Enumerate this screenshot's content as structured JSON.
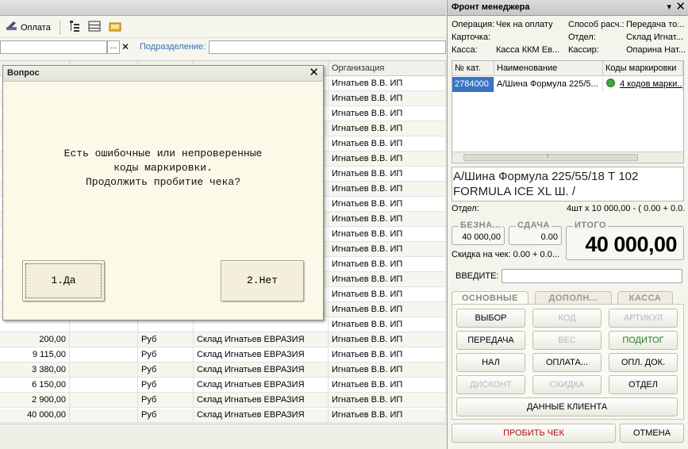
{
  "main": {
    "toolbar": {
      "pay_label": "Оплата"
    },
    "filter": {
      "dots": "...",
      "clear": "✕",
      "dept_label": "Подразделение:"
    },
    "grid": {
      "headers": {
        "org": "Организация"
      },
      "rows": [
        {
          "sum": "",
          "cur": "",
          "wh": "",
          "org": "Игнатьев В.В. ИП"
        },
        {
          "sum": "",
          "cur": "",
          "wh": "",
          "org": "Игнатьев В.В. ИП"
        },
        {
          "sum": "",
          "cur": "",
          "wh": "",
          "org": "Игнатьев В.В. ИП"
        },
        {
          "sum": "",
          "cur": "",
          "wh": "",
          "org": "Игнатьев В.В. ИП"
        },
        {
          "sum": "",
          "cur": "",
          "wh": "",
          "org": "Игнатьев В.В. ИП"
        },
        {
          "sum": "",
          "cur": "",
          "wh": "",
          "org": "Игнатьев В.В. ИП"
        },
        {
          "sum": "",
          "cur": "",
          "wh": "",
          "org": "Игнатьев В.В. ИП"
        },
        {
          "sum": "",
          "cur": "",
          "wh": "",
          "org": "Игнатьев В.В. ИП"
        },
        {
          "sum": "",
          "cur": "",
          "wh": "",
          "org": "Игнатьев В.В. ИП"
        },
        {
          "sum": "",
          "cur": "",
          "wh": "",
          "org": "Игнатьев В.В. ИП"
        },
        {
          "sum": "",
          "cur": "",
          "wh": "",
          "org": "Игнатьев В.В. ИП"
        },
        {
          "sum": "",
          "cur": "",
          "wh": "",
          "org": "Игнатьев В.В. ИП"
        },
        {
          "sum": "",
          "cur": "",
          "wh": "",
          "org": "Игнатьев В.В. ИП"
        },
        {
          "sum": "",
          "cur": "",
          "wh": "",
          "org": "Игнатьев В.В. ИП"
        },
        {
          "sum": "",
          "cur": "",
          "wh": "",
          "org": "Игнатьев В.В. ИП"
        },
        {
          "sum": "",
          "cur": "",
          "wh": "",
          "org": "Игнатьев В.В. ИП"
        },
        {
          "sum": "",
          "cur": "",
          "wh": "",
          "org": "Игнатьев В.В. ИП"
        },
        {
          "sum": "200,00",
          "cur": "Руб",
          "wh": "Склад Игнатьев ЕВРАЗИЯ",
          "org": "Игнатьев В.В. ИП"
        },
        {
          "sum": "9 115,00",
          "cur": "Руб",
          "wh": "Склад Игнатьев ЕВРАЗИЯ",
          "org": "Игнатьев В.В. ИП"
        },
        {
          "sum": "3 380,00",
          "cur": "Руб",
          "wh": "Склад Игнатьев ЕВРАЗИЯ",
          "org": "Игнатьев В.В. ИП"
        },
        {
          "sum": "6 150,00",
          "cur": "Руб",
          "wh": "Склад Игнатьев ЕВРАЗИЯ",
          "org": "Игнатьев В.В. ИП"
        },
        {
          "sum": "2 900,00",
          "cur": "Руб",
          "wh": "Склад Игнатьев ЕВРАЗИЯ",
          "org": "Игнатьев В.В. ИП"
        },
        {
          "sum": "40 000,00",
          "cur": "Руб",
          "wh": "Склад Игнатьев ЕВРАЗИЯ",
          "org": "Игнатьев В.В. ИП"
        }
      ]
    }
  },
  "dialog": {
    "title": "Вопрос",
    "close": "✕",
    "message": "Есть ошибочные или непроверенные\nкоды маркировки.\nПродолжить пробитие чека?",
    "yes_label": "1.Да",
    "no_label": "2.Нет"
  },
  "front": {
    "title": "Фронт менеджера",
    "pin": "▾",
    "close": "✕",
    "info": {
      "operation_label": "Операция:",
      "operation_value": "Чек на оплату",
      "card_label": "Карточка:",
      "cashbox_label": "Касса:",
      "cashbox_value": "Касса ККМ Ев...",
      "payment_label": "Способ расч.:",
      "payment_value": "Передача то...",
      "dept_label": "Отдел:",
      "dept_value": "Склад Игнат...",
      "cashier_label": "Кассир:",
      "cashier_value": "Опарина Нат..."
    },
    "table": {
      "headers": {
        "cat": "№ кат.",
        "name": "Наименование",
        "codes": "Коды маркировки"
      },
      "row": {
        "cat": "2784000",
        "name": "А/Шина Формула 225/5...",
        "codes": "4 кодов марки..."
      },
      "scroll_marker": "г"
    },
    "description": "А/Шина Формула 225/55/18 Т 102 FORMULA ICE XL Ш. /",
    "dept_line_label": "Отдел:",
    "qty_line": "4шт x 10 000,00 - ( 0.00 + 0.0...",
    "cashless_caption": "БЕЗНА...",
    "cashless_value": "40 000,00",
    "change_caption": "СДАЧА",
    "change_value": "0.00",
    "total_caption": "ИТОГО",
    "total_value": "40 000,00",
    "discount_line": "Скидка на чек: 0.00 + 0.0...",
    "input_label": "ВВЕДИТЕ:",
    "tabs": {
      "basic": "ОСНОВНЫЕ",
      "extra": "ДОПОЛН...",
      "cash": "КАССА"
    },
    "buttons": {
      "select": "ВЫБОР",
      "code": "КОД",
      "article": "АРТИКУЛ",
      "transfer": "ПЕРЕДАЧА",
      "weight": "ВЕС",
      "subtotal": "ПОДИТОГ",
      "cash": "НАЛ",
      "payment": "ОПЛАТА...",
      "pay_doc": "ОПЛ. ДОК.",
      "discount_card": "ДИСКОНТ",
      "discount": "СКИДКА",
      "department": "ОТДЕЛ",
      "client_data": "ДАННЫЕ КЛИЕНТА",
      "print_check": "ПРОБИТЬ ЧЕК",
      "cancel": "ОТМЕНА"
    },
    "colors": {
      "green_status": "#3fa53f",
      "selected_row": "#3a73c4"
    }
  }
}
